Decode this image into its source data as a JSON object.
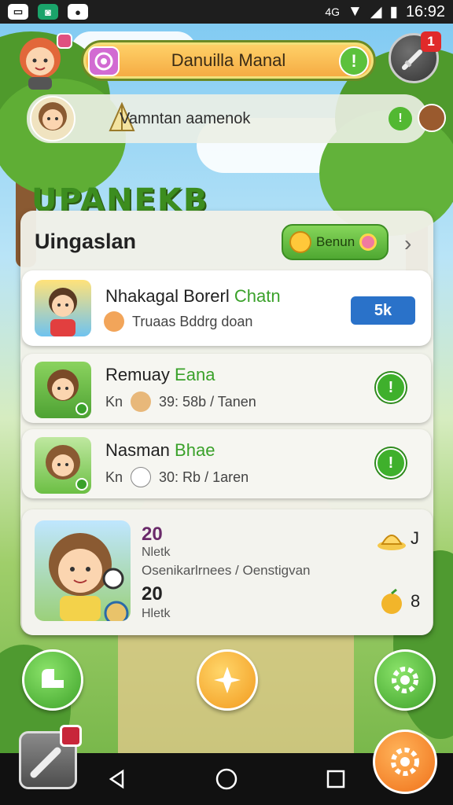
{
  "status_bar": {
    "time": "16:92",
    "network": "4G"
  },
  "header": {
    "title": "Danuilla Manal",
    "subtitle": "Vamntan aamenok",
    "notification_count": "1",
    "sign_text": "UPANEKB"
  },
  "panel": {
    "title": "Uingaslan",
    "pill_label": "Benun",
    "rows": [
      {
        "name": "Nhakagal Borerl ",
        "name_accent": "Chatn",
        "meta": "Truaas Bddrg doan",
        "button_label": "5k"
      },
      {
        "name": "Remuay ",
        "name_accent": "Eana",
        "prefix": "Kn",
        "meta": "39: 58b / Tanen"
      },
      {
        "name": "Nasman ",
        "name_accent": "Bhae",
        "prefix": "Kn",
        "meta": "30: Rb / 1aren"
      }
    ],
    "card": {
      "value1": "20",
      "label1": "Nletk",
      "middle": "Osenikarlrnees / Oenstigvan",
      "value2": "20",
      "label2": "Hletk",
      "right_value1": "J",
      "right_value2": "8"
    }
  },
  "colors": {
    "accent_green": "#3fb02c",
    "accent_orange": "#f29a1e",
    "blue": "#2a72c9"
  }
}
